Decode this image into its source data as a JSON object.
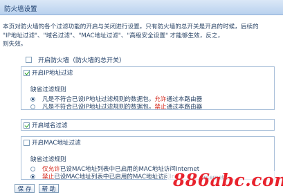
{
  "title": "防火墙设置",
  "description": [
    "本页对防火墙的各个过滤功能的开启与关闭进行设置。只有防火墙的总开关是开启的时候，后续的",
    "\"IP地址过滤\"、\"域名过滤\"、\"MAC地址过滤\"、\"高级安全设置\" 才能够生效，反之，",
    "则失效。"
  ],
  "master_switch": {
    "label": "开启防火墙（防火墙的总开关）",
    "checked": false
  },
  "ip_filter": {
    "label": "开启IP地址过滤",
    "checked": true,
    "default_rule_title": "缺省过滤规则",
    "options": [
      {
        "pre": "凡是不符合已设IP地址过滤规则的数据包，",
        "highlight": "允许",
        "post": "通过本路由器",
        "selected": true
      },
      {
        "pre": "凡是不符合已设IP地址过滤规则的数据包，",
        "highlight": "禁止",
        "post": "通过本路由器",
        "selected": false
      }
    ]
  },
  "domain_filter": {
    "label": "开启域名过滤",
    "checked": true
  },
  "mac_filter": {
    "label": "开启MAC地址过滤",
    "checked": false,
    "default_rule_title": "缺省过滤规则",
    "options": [
      {
        "pre": "",
        "highlight": "仅允许",
        "post": "已设MAC地址列表中已启用的MAC地址访问Internet",
        "selected": false
      },
      {
        "pre": "",
        "highlight": "禁止",
        "post": "已设MAC地址列表中已启用的MAC地址访问Int",
        "selected": true
      }
    ]
  },
  "buttons": {
    "save": "保 存",
    "help": "帮 助"
  },
  "watermark": {
    "text": "886abc.com",
    "hidden_fragment": "Internet"
  },
  "colors": {
    "accent_red": "#d4261a",
    "text_blue": "#1f3d66",
    "frame": "#a8bfd9",
    "watermark_red": "#e8232d"
  }
}
